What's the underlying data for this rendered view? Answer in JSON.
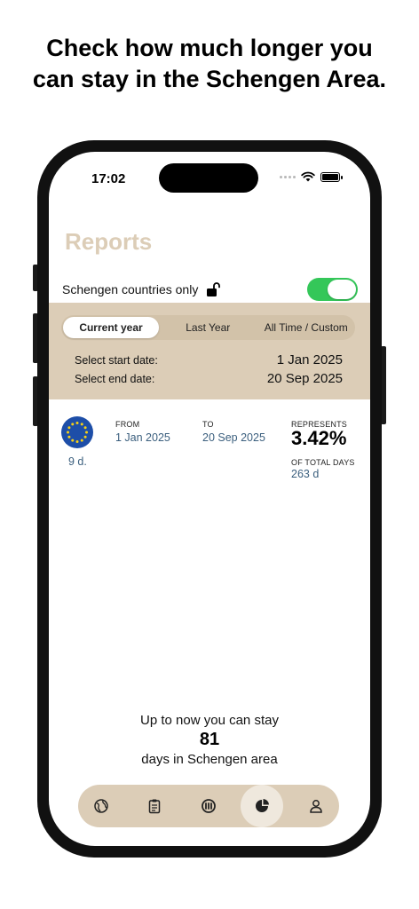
{
  "headline": "Check how much longer you can stay in the Schengen Area.",
  "status_bar": {
    "time": "17:02"
  },
  "page_title": "Reports",
  "schengen_filter": {
    "label": "Schengen countries only",
    "toggle_on": true
  },
  "range_tabs": [
    "Current year",
    "Last Year",
    "All Time / Custom"
  ],
  "selected_tab": "Current year",
  "dates": {
    "start_label": "Select start date:",
    "start_value": "1 Jan 2025",
    "end_label": "Select end date:",
    "end_value": "20 Sep 2025"
  },
  "report": {
    "days": "9 d.",
    "from_label": "FROM",
    "from_value": "1 Jan 2025",
    "to_label": "TO",
    "to_value": "20 Sep 2025",
    "represents_label": "REPRESENTS",
    "percentage": "3.42%",
    "total_label": "OF TOTAL DAYS",
    "total_value": "263 d"
  },
  "stay": {
    "pre": "Up to now you can stay",
    "days": "81",
    "post": "days in Schengen area"
  },
  "tabbar": {
    "items": [
      "globe-icon",
      "clipboard-icon",
      "schengen-icon",
      "pie-chart-icon",
      "person-icon"
    ],
    "active": "pie-chart-icon"
  },
  "colors": {
    "accent": "#dccdb7",
    "toggle_on": "#34c759",
    "link": "#3b5f7e",
    "eu_blue": "#1d4ea8"
  }
}
